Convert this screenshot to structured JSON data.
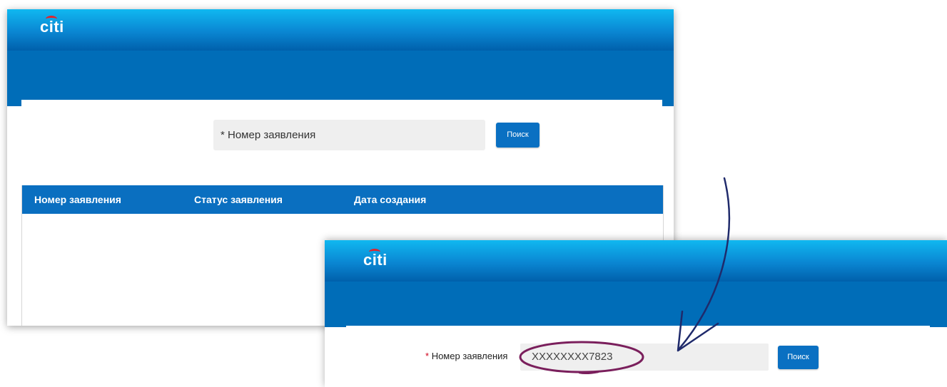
{
  "brand": {
    "logo_text": "citi",
    "accent_color": "#006db8",
    "logo_arc_color": "#e0242b"
  },
  "panel_search": {
    "search": {
      "placeholder": "* Номер заявления"
    },
    "search_button_label": "Поиск",
    "table": {
      "columns": [
        "Номер заявления",
        "Статус заявления",
        "Дата создания"
      ],
      "rows": []
    }
  },
  "panel_filled": {
    "required_mark": "*",
    "field_label": "Номер заявления",
    "field_value": "XXXXXXXX7823",
    "search_button_label": "Поиск"
  },
  "annotation": {
    "highlight_color": "#7a1f5c",
    "arrow_color": "#1f2a6b"
  }
}
